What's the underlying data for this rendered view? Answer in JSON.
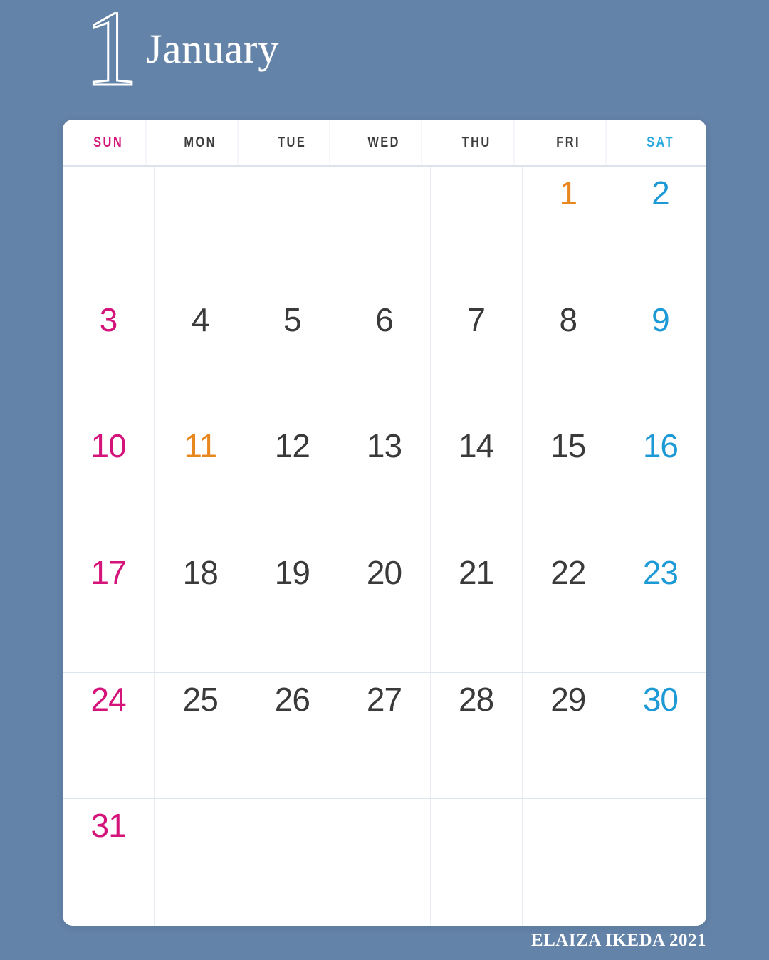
{
  "background_color": "#6483a8",
  "header": {
    "month_numeral": "1",
    "month_name": "January"
  },
  "weekday_headers": [
    {
      "label": "SUN",
      "kind": "sun"
    },
    {
      "label": "MON",
      "kind": "weekday"
    },
    {
      "label": "TUE",
      "kind": "weekday"
    },
    {
      "label": "WED",
      "kind": "weekday"
    },
    {
      "label": "THU",
      "kind": "weekday"
    },
    {
      "label": "FRI",
      "kind": "weekday"
    },
    {
      "label": "SAT",
      "kind": "sat"
    }
  ],
  "colors": {
    "sunday": "#d4147a",
    "saturday": "#1d9ad6",
    "holiday": "#e8871e",
    "weekday": "#3a3a3a",
    "card": "#ffffff",
    "grid_line": "#e9ecf2",
    "row_line": "#dfe5ee"
  },
  "weeks": [
    [
      {
        "day": "",
        "kind": "empty"
      },
      {
        "day": "",
        "kind": "empty"
      },
      {
        "day": "",
        "kind": "empty"
      },
      {
        "day": "",
        "kind": "empty"
      },
      {
        "day": "",
        "kind": "empty"
      },
      {
        "day": "1",
        "kind": "holiday"
      },
      {
        "day": "2",
        "kind": "sat"
      }
    ],
    [
      {
        "day": "3",
        "kind": "sun"
      },
      {
        "day": "4",
        "kind": "weekday"
      },
      {
        "day": "5",
        "kind": "weekday"
      },
      {
        "day": "6",
        "kind": "weekday"
      },
      {
        "day": "7",
        "kind": "weekday"
      },
      {
        "day": "8",
        "kind": "weekday"
      },
      {
        "day": "9",
        "kind": "sat"
      }
    ],
    [
      {
        "day": "10",
        "kind": "sun"
      },
      {
        "day": "11",
        "kind": "holiday"
      },
      {
        "day": "12",
        "kind": "weekday"
      },
      {
        "day": "13",
        "kind": "weekday"
      },
      {
        "day": "14",
        "kind": "weekday"
      },
      {
        "day": "15",
        "kind": "weekday"
      },
      {
        "day": "16",
        "kind": "sat"
      }
    ],
    [
      {
        "day": "17",
        "kind": "sun"
      },
      {
        "day": "18",
        "kind": "weekday"
      },
      {
        "day": "19",
        "kind": "weekday"
      },
      {
        "day": "20",
        "kind": "weekday"
      },
      {
        "day": "21",
        "kind": "weekday"
      },
      {
        "day": "22",
        "kind": "weekday"
      },
      {
        "day": "23",
        "kind": "sat"
      }
    ],
    [
      {
        "day": "24",
        "kind": "sun"
      },
      {
        "day": "25",
        "kind": "weekday"
      },
      {
        "day": "26",
        "kind": "weekday"
      },
      {
        "day": "27",
        "kind": "weekday"
      },
      {
        "day": "28",
        "kind": "weekday"
      },
      {
        "day": "29",
        "kind": "weekday"
      },
      {
        "day": "30",
        "kind": "sat"
      }
    ],
    [
      {
        "day": "31",
        "kind": "sun"
      },
      {
        "day": "",
        "kind": "empty"
      },
      {
        "day": "",
        "kind": "empty"
      },
      {
        "day": "",
        "kind": "empty"
      },
      {
        "day": "",
        "kind": "empty"
      },
      {
        "day": "",
        "kind": "empty"
      },
      {
        "day": "",
        "kind": "empty"
      }
    ]
  ],
  "credit": "ELAIZA IKEDA 2021"
}
